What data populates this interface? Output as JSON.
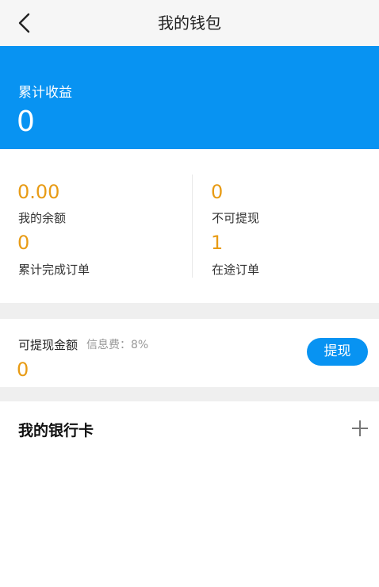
{
  "nav": {
    "title": "我的钱包"
  },
  "banner": {
    "label": "累计收益",
    "value": "0"
  },
  "stats": {
    "balance_value": "0.00",
    "balance_label": "我的余额",
    "locked_value": "0",
    "locked_label": "不可提现",
    "completed_value": "0",
    "completed_label": "累计完成订单",
    "transit_value": "1",
    "transit_label": "在途订单"
  },
  "withdraw": {
    "label": "可提现金额",
    "fee": "信息费：8%",
    "value": "0",
    "button_label": "提现"
  },
  "bank": {
    "title": "我的银行卡"
  },
  "colors": {
    "accent": "#0893f2",
    "amount": "#e89b14",
    "background_gap": "#efefef"
  },
  "icons": {
    "back": "chevron-left-icon",
    "add": "plus-icon"
  }
}
